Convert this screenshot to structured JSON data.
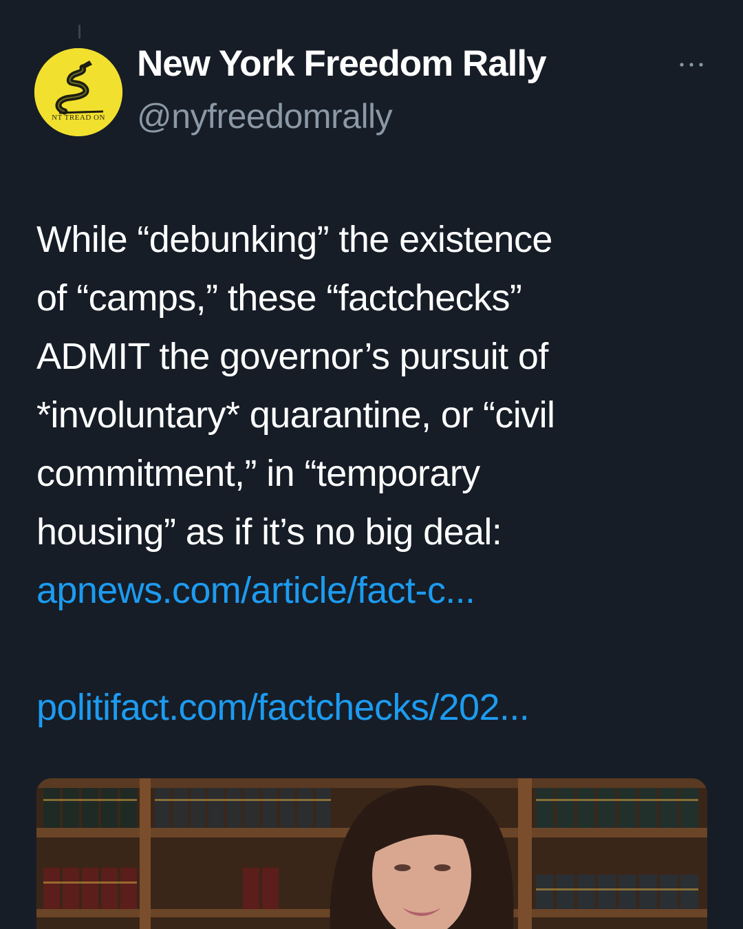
{
  "tweet": {
    "author": {
      "display_name": "New York Freedom Rally",
      "handle": "@nyfreedomrally",
      "avatar_icon": "gadsden-flag-icon",
      "avatar_text": "NT TREAD ON",
      "avatar_color": "#f2e02f"
    },
    "more_icon": "more-horizontal-icon",
    "text_lines": [
      "While “debunking” the existence",
      "of “camps,” these “factchecks”",
      "ADMIT the governor’s pursuit of",
      "*involuntary* quarantine, or “civil",
      "commitment,” in “temporary",
      "housing” as if it’s no big deal:"
    ],
    "links": {
      "ap": "apnews.com/article/fact-c...",
      "politifact": "politifact.com/factchecks/202..."
    },
    "media": {
      "description_icon": "news-photo-image"
    }
  },
  "colors": {
    "background": "#161d27",
    "text": "#ffffff",
    "secondary": "#8b98a6",
    "link": "#1d9bf0"
  }
}
